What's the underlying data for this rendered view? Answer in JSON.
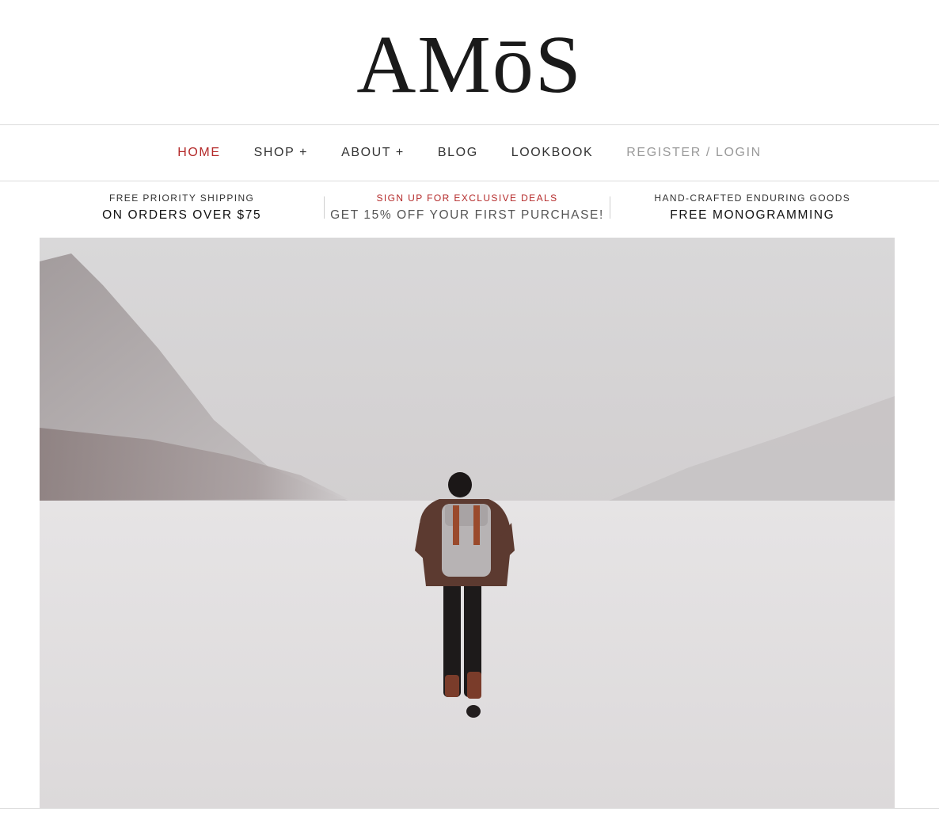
{
  "brand": {
    "logo_text": "AMōS"
  },
  "nav": {
    "items": [
      {
        "label": "HOME",
        "state": "active"
      },
      {
        "label": "SHOP +",
        "state": "normal"
      },
      {
        "label": "ABOUT +",
        "state": "normal"
      },
      {
        "label": "BLOG",
        "state": "normal"
      },
      {
        "label": "LOOKBOOK",
        "state": "normal"
      },
      {
        "label": "REGISTER / LOGIN",
        "state": "muted"
      }
    ]
  },
  "promos": [
    {
      "top": "FREE PRIORITY SHIPPING",
      "bottom": "ON ORDERS OVER $75"
    },
    {
      "top": "SIGN UP FOR EXCLUSIVE DEALS",
      "bottom": "GET 15% OFF YOUR FIRST PURCHASE!"
    },
    {
      "top": "HAND-CRAFTED ENDURING GOODS",
      "bottom": "FREE MONOGRAMMING"
    }
  ],
  "colors": {
    "accent": "#b42a2a",
    "text": "#333333",
    "muted": "#9a9a9a",
    "rule": "#dcdcdc"
  }
}
